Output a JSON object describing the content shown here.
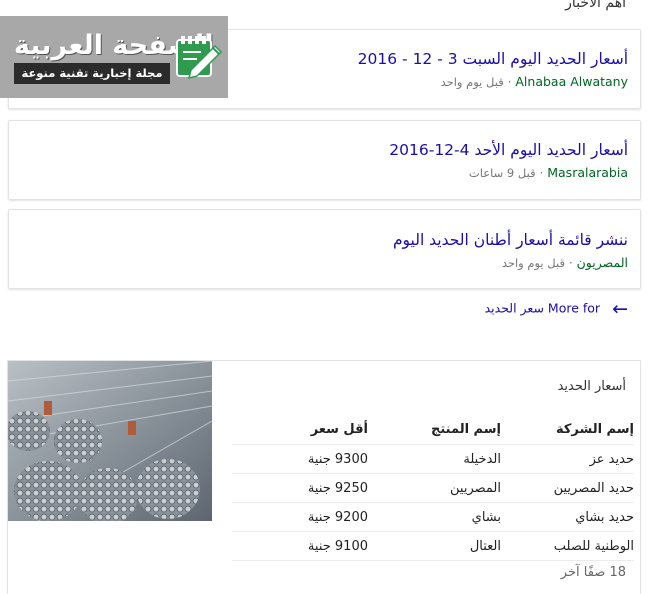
{
  "header": {
    "title": "أهم الأخبار"
  },
  "logo": {
    "title": "الصفحة العربية",
    "subtitle": "مجلة إخبارية تقنية منوعة"
  },
  "news": [
    {
      "title": "أسعار الحديد اليوم السبت 3 - 12 - 2016",
      "source": "Alnabaa Alwatany",
      "time": "قبل يوم واحد"
    },
    {
      "title": "أسعار الحديد اليوم الأحد 4-12-2016",
      "source": "Masralarabia",
      "time": "قبل 9 ساعات"
    },
    {
      "title": "ننشر قائمة أسعار أطنان الحديد اليوم",
      "source": "المصريون",
      "time": "قبل يوم واحد"
    }
  ],
  "more_link": {
    "label": "More for",
    "query": "سعر الحديد"
  },
  "prices_card": {
    "title": "أسعار الحديد",
    "columns": [
      "إسم الشركة",
      "إسم المنتج",
      "أقل سعر"
    ],
    "rows": [
      [
        "حديد عز",
        "الدخيلة",
        "9300 جنية"
      ],
      [
        "حديد المصريين",
        "المصريين",
        "9250 جنية"
      ],
      [
        "حديد بشاي",
        "بشاي",
        "9200 جنية"
      ],
      [
        "الوطنية للصلب",
        "العتال",
        "9100 جنية"
      ]
    ],
    "more_rows": "18 صفًا آخر"
  },
  "colors": {
    "link": "#1a0dab",
    "source": "#006621",
    "meta": "#777777",
    "logo_bg": "#a8a8a8",
    "logo_accent": "#2e9b4e"
  },
  "icons": {
    "back": "arrow-left-icon",
    "logo": "pencil-note-icon",
    "image": "steel-rebar-photo"
  }
}
